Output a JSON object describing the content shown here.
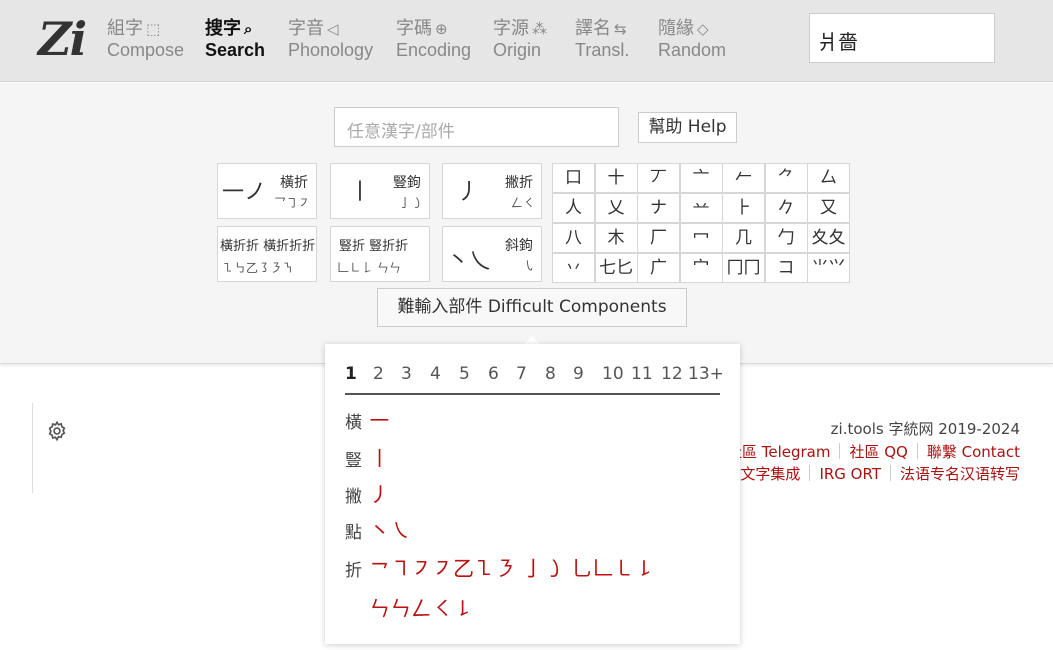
{
  "header": {
    "logo": "Zi",
    "nav": [
      {
        "zh": "組字",
        "icon": "⬚",
        "en": "Compose"
      },
      {
        "zh": "搜字",
        "icon": "🔍",
        "en": "Search"
      },
      {
        "zh": "字音",
        "icon": "◁",
        "en": "Phonology"
      },
      {
        "zh": "字碼",
        "icon": "🌐",
        "en": "Encoding"
      },
      {
        "zh": "字源",
        "icon": "⁂",
        "en": "Origin"
      },
      {
        "zh": "譯名",
        "icon": "⇆",
        "en": "Transl."
      },
      {
        "zh": "隨緣",
        "icon": "◇",
        "en": "Random"
      }
    ],
    "active_nav": "Search",
    "query_value": "爿嗇"
  },
  "search": {
    "placeholder": "任意漢字/部件",
    "help_label": "幫助 Help",
    "difficult_label": "難輸入部件 Difficult Components"
  },
  "stroke_boxes": [
    {
      "big": "一ノ",
      "label": "橫折",
      "sub": "乛㇆㇇"
    },
    {
      "big": "丨",
      "label": "豎鉤",
      "sub": "亅㇁"
    },
    {
      "big": "丿",
      "label": "撇折",
      "sub": "𠃋㇛"
    },
    {
      "big": "",
      "label": "橫折折 橫折折折",
      "sub": "㇅㇉乙㇌㇋㇎"
    },
    {
      "big": "",
      "label": "豎折 豎折折",
      "sub": "𠃊㇗𠄌 ㄣㄣ"
    },
    {
      "big": "丶乀",
      "label": "斜鉤",
      "sub": "㇂"
    }
  ],
  "components": [
    [
      "口",
      "十",
      "丆",
      "亠",
      "𠂉",
      "⺈",
      "厶"
    ],
    [
      "人",
      "乂",
      "ナ",
      "䒑",
      "⺊",
      "𠂊",
      "又"
    ],
    [
      "八",
      "木",
      "厂",
      "冖",
      "几",
      "勹",
      "夊夂"
    ],
    [
      "丷",
      "七匕",
      "广",
      "宀",
      "冂冂",
      "コ",
      "⺌⺍"
    ]
  ],
  "popup": {
    "counts": [
      "1",
      "2",
      "3",
      "4",
      "5",
      "6",
      "7",
      "8",
      "9",
      "10",
      "11",
      "12",
      "13+"
    ],
    "active_count": "1",
    "rows": [
      {
        "label": "橫",
        "glyphs": "㇐"
      },
      {
        "label": "豎",
        "glyphs": "㇑"
      },
      {
        "label": "撇",
        "glyphs": "㇓"
      },
      {
        "label": "點",
        "glyphs": "㇔㇏"
      },
      {
        "label": "折",
        "glyphs": "㇖㇕㇇㇇乙㇅㇋ 亅㇁ 乚𠃊㇄㇙"
      },
      {
        "label": "",
        "glyphs": "ㄣㄣ𠃋㇛㇙"
      }
    ]
  },
  "footer": {
    "copyright": "zi.tools 字統网 2019-2024",
    "links_row1": [
      "社區 Telegram",
      "社區 QQ",
      "聯繫 Contact"
    ],
    "links_row2": [
      "文字集成",
      "IRG ORT",
      "法语专名汉语转写"
    ]
  },
  "colors": {
    "accent": "#aa1111",
    "header_bg": "#e6e6e6",
    "panel_bg": "#f5f5f5"
  }
}
